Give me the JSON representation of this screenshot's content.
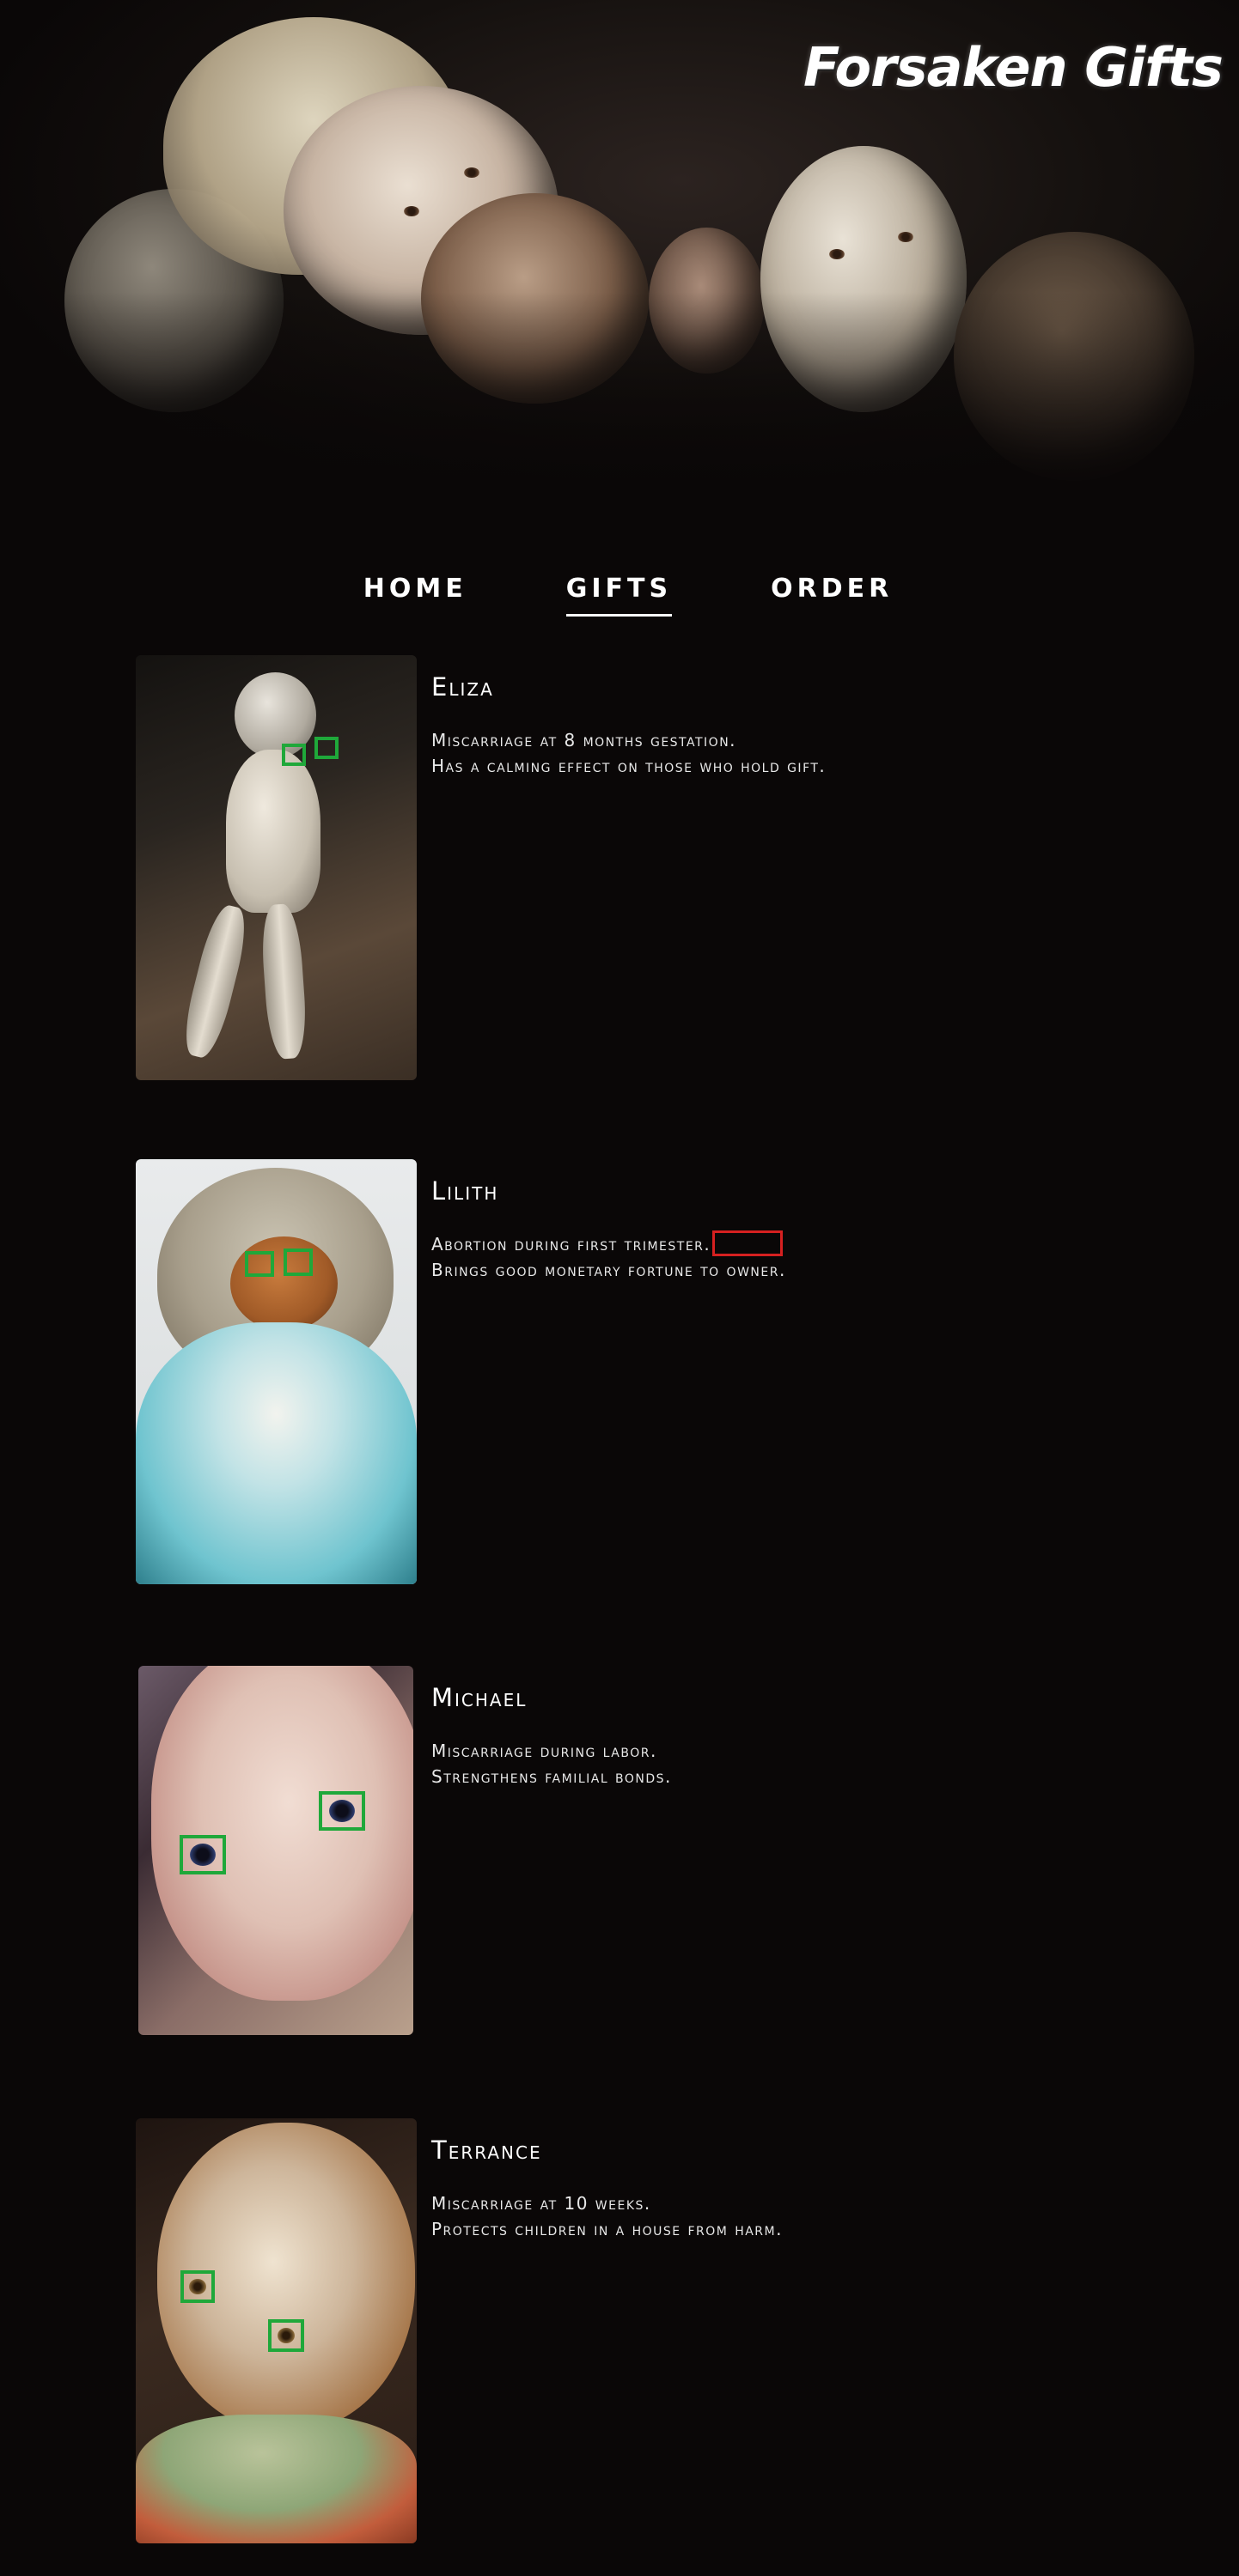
{
  "site": {
    "title": "Forsaken Gifts"
  },
  "nav": {
    "items": [
      {
        "label": "Home",
        "active": false
      },
      {
        "label": "Gifts",
        "active": true
      },
      {
        "label": "Order",
        "active": false
      }
    ]
  },
  "gifts": [
    {
      "name": "Eliza",
      "line1": "Miscarriage at 8 months gestation.",
      "line2": "Has a calming effect on those who hold gift."
    },
    {
      "name": "Lilith",
      "line1": "Abortion during first trimester.",
      "line2": "Brings good monetary fortune to owner."
    },
    {
      "name": "Michael",
      "line1": "Miscarriage during labor.",
      "line2": "Strengthens familial bonds."
    },
    {
      "name": "Terrance",
      "line1": "Miscarriage at 10 weeks.",
      "line2": "Protects children in a house from harm."
    }
  ],
  "colors": {
    "background": "#0a0707",
    "highlight_green": "#1fa83a",
    "highlight_red": "#d62020",
    "text": "#ffffff"
  }
}
